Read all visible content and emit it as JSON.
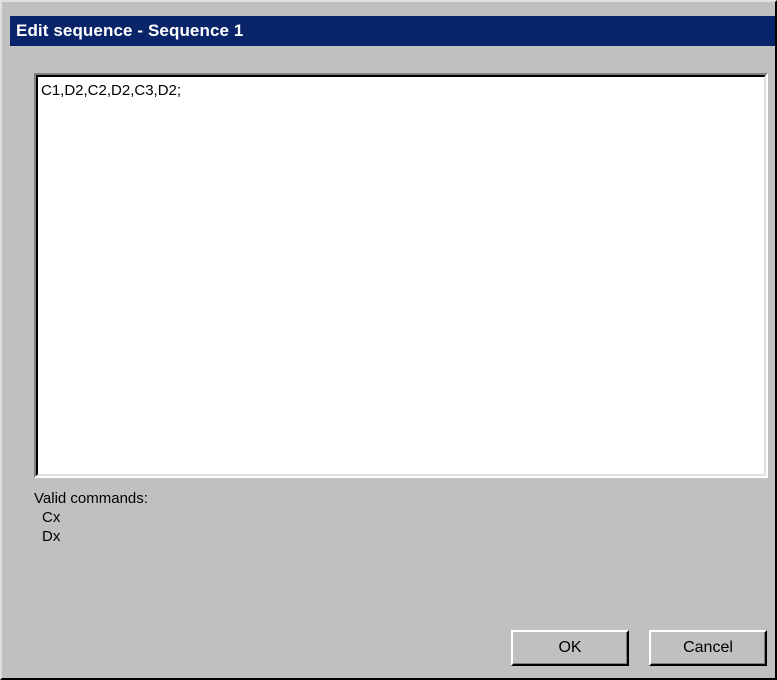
{
  "window": {
    "title": "Edit sequence - Sequence 1"
  },
  "editor": {
    "value": "C1,D2,C2,D2,C3,D2;"
  },
  "help": {
    "heading": "Valid commands:",
    "commands": [
      "Cx",
      "Dx"
    ]
  },
  "buttons": {
    "ok": "OK",
    "cancel": "Cancel"
  },
  "colors": {
    "titlebar": "#0a246a",
    "dialog_background": "#c0c0c0"
  }
}
